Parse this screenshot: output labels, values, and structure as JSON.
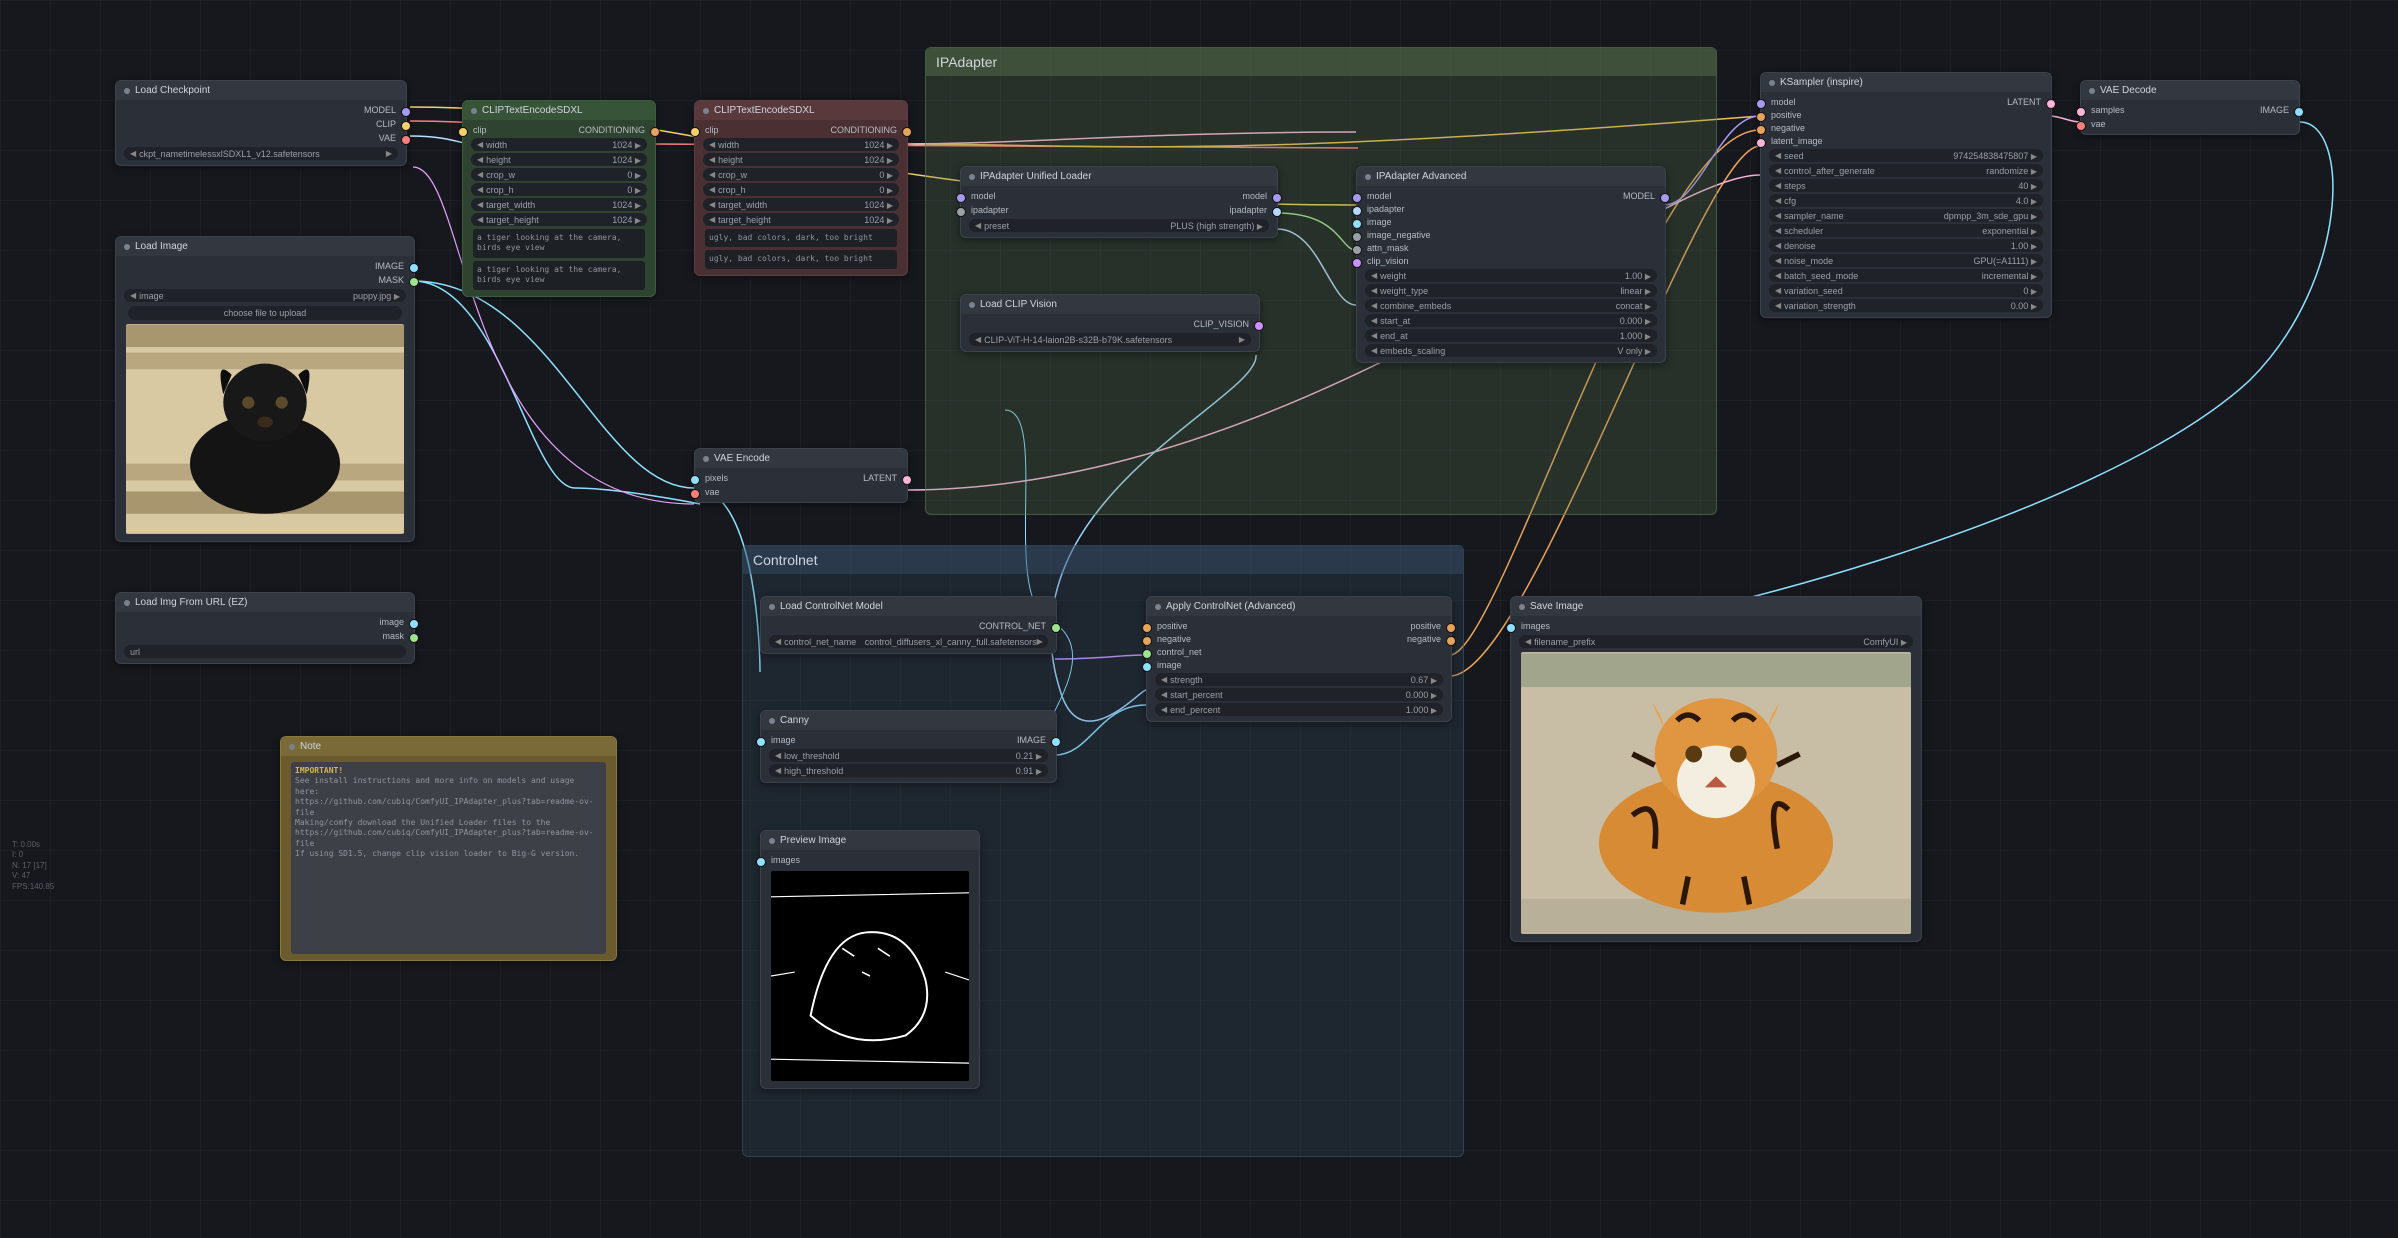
{
  "perf": {
    "t": "T: 0.00s",
    "i": "I: 0",
    "n": "N: 17 [17]",
    "v": "V: 47",
    "fps": "FPS:140.85"
  },
  "groups": {
    "ipadapter": {
      "title": "IPAdapter"
    },
    "controlnet": {
      "title": "Controlnet"
    }
  },
  "loadCheckpoint": {
    "title": "Load Checkpoint",
    "outputs": [
      "MODEL",
      "CLIP",
      "VAE"
    ],
    "ckpt_label": "ckpt_nametimelessxlSDXL1_v12.safetensors"
  },
  "loadImage": {
    "title": "Load Image",
    "outputs": [
      "IMAGE",
      "MASK"
    ],
    "image_label": "image",
    "image_value": "puppy.jpg",
    "upload": "choose file to upload"
  },
  "loadImgUrl": {
    "title": "Load Img From URL (EZ)",
    "outputs": [
      "image",
      "mask"
    ],
    "url_label": "url"
  },
  "note": {
    "title": "Note",
    "heading": "IMPORTANT!",
    "text": "See install instructions and more info on models and usage here:\nhttps://github.com/cubiq/ComfyUI_IPAdapter_plus?tab=readme-ov-file\nMaking/comfy download the Unified Loader files to the\nhttps://github.com/cubiq/ComfyUI_IPAdapter_plus?tab=readme-ov-file\nIf using SD1.5, change clip vision loader to Big-G version."
  },
  "clipPos": {
    "title": "CLIPTextEncodeSDXL",
    "clip": "clip",
    "cond": "CONDITIONING",
    "width": "1024",
    "height": "1024",
    "crop_w": "0",
    "crop_h": "0",
    "target_width": "1024",
    "target_height": "1024",
    "txt1": "a tiger looking at the camera, birds eye view",
    "txt2": "a tiger looking at the camera, birds eye view"
  },
  "clipNeg": {
    "title": "CLIPTextEncodeSDXL",
    "clip": "clip",
    "cond": "CONDITIONING",
    "width": "1024",
    "height": "1024",
    "crop_w": "0",
    "crop_h": "0",
    "target_width": "1024",
    "target_height": "1024",
    "txt1": "ugly, bad colors, dark, too bright",
    "txt2": "ugly, bad colors, dark, too bright"
  },
  "vaeEncode": {
    "title": "VAE Encode",
    "pixels": "pixels",
    "vae": "vae",
    "latent": "LATENT"
  },
  "ipUnified": {
    "title": "IPAdapter Unified Loader",
    "model_in": "model",
    "model_out": "model",
    "ipadapter_out": "ipadapter",
    "preset_label": "preset",
    "preset_value": "PLUS (high strength)"
  },
  "loadClipVision": {
    "title": "Load CLIP Vision",
    "out": "CLIP_VISION",
    "clip_label": "CLIP-ViT-H-14-laion2B-s32B-b79K.safetensors"
  },
  "ipAdv": {
    "title": "IPAdapter Advanced",
    "inputs": [
      "model",
      "ipadapter",
      "image",
      "image_negative",
      "attn_mask",
      "clip_vision"
    ],
    "output": "MODEL",
    "weight": "1.00",
    "weight_type": "linear",
    "combine_embeds": "concat",
    "start_at": "0.000",
    "end_at": "1.000",
    "embeds_scaling": "V only"
  },
  "ksampler": {
    "title": "KSampler (inspire)",
    "inputs": [
      "model",
      "positive",
      "negative",
      "latent_image"
    ],
    "output": "LATENT",
    "seed": "974254838475807",
    "control_after_generate": "randomize",
    "steps": "40",
    "cfg": "4.0",
    "sampler_name": "dpmpp_3m_sde_gpu",
    "scheduler": "exponential",
    "denoise": "1.00",
    "noise_mode": "GPU(=A1111)",
    "batch_seed_mode": "incremental",
    "variation_seed": "0",
    "variation_strength": "0.00"
  },
  "vaeDecode": {
    "title": "VAE Decode",
    "samples": "samples",
    "vae": "vae",
    "image": "IMAGE"
  },
  "loadCN": {
    "title": "Load ControlNet Model",
    "out": "CONTROL_NET",
    "model": "control_diffusers_xl_canny_full.safetensors"
  },
  "canny": {
    "title": "Canny",
    "img_in": "image",
    "img_out": "IMAGE",
    "low": "0.21",
    "high": "0.91"
  },
  "applyCN": {
    "title": "Apply ControlNet (Advanced)",
    "in": [
      "positive",
      "negative",
      "control_net",
      "image"
    ],
    "out": [
      "positive",
      "negative"
    ],
    "strength": "0.67",
    "start_percent": "0.000",
    "end_percent": "1.000"
  },
  "preview": {
    "title": "Preview Image",
    "images": "images"
  },
  "saveImage": {
    "title": "Save Image",
    "images": "images",
    "prefix_label": "filename_prefix",
    "prefix_value": "ComfyUI"
  },
  "labels": {
    "width": "width",
    "height": "height",
    "crop_w": "crop_w",
    "crop_h": "crop_h",
    "target_width": "target_width",
    "target_height": "target_height",
    "weight": "weight",
    "weight_type": "weight_type",
    "combine_embeds": "combine_embeds",
    "start_at": "start_at",
    "end_at": "end_at",
    "embeds_scaling": "embeds_scaling",
    "seed": "seed",
    "control_after_generate": "control_after_generate",
    "steps": "steps",
    "cfg": "cfg",
    "sampler_name": "sampler_name",
    "scheduler": "scheduler",
    "denoise": "denoise",
    "noise_mode": "noise_mode",
    "batch_seed_mode": "batch_seed_mode",
    "variation_seed": "variation_seed",
    "variation_strength": "variation_strength",
    "low_threshold": "low_threshold",
    "high_threshold": "high_threshold",
    "strength": "strength",
    "start_percent": "start_percent",
    "end_percent": "end_percent",
    "control_net_name": "control_net_name"
  }
}
